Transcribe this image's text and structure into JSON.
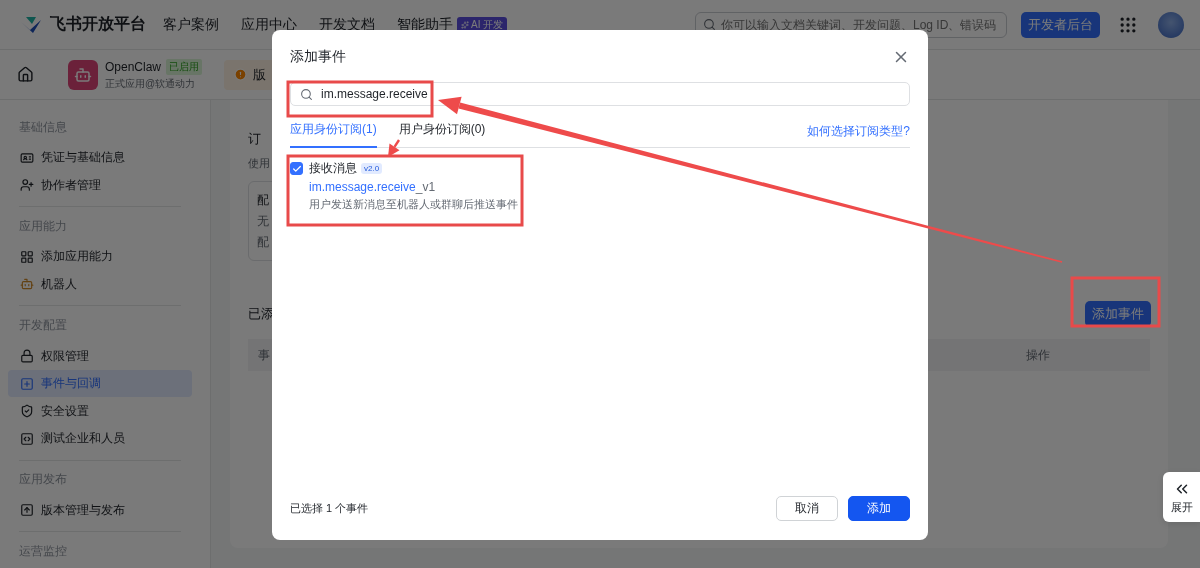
{
  "header": {
    "logo": "飞书开放平台",
    "nav": [
      {
        "label": "客户案例"
      },
      {
        "label": "应用中心"
      },
      {
        "label": "开发文档"
      },
      {
        "label": "智能助手",
        "badge": "AI 开发"
      }
    ],
    "search": {
      "placeholder": "你可以输入文档关键词、开发问题、Log ID、错误码"
    },
    "console_button": "开发者后台"
  },
  "app_bar": {
    "app_name": "OpenClaw",
    "status": "已启用",
    "subtitle": "正式应用@软通动力",
    "notice": "版"
  },
  "sidebar": {
    "groups": [
      {
        "title": "基础信息",
        "items": [
          {
            "label": "凭证与基础信息",
            "selected": false
          },
          {
            "label": "协作者管理",
            "selected": false
          }
        ]
      },
      {
        "title": "应用能力",
        "items": [
          {
            "label": "添加应用能力",
            "selected": false
          },
          {
            "label": "机器人",
            "selected": false
          }
        ]
      },
      {
        "title": "开发配置",
        "items": [
          {
            "label": "权限管理",
            "selected": false
          },
          {
            "label": "事件与回调",
            "selected": true
          },
          {
            "label": "安全设置",
            "selected": false
          },
          {
            "label": "测试企业和人员",
            "selected": false
          }
        ]
      },
      {
        "title": "应用发布",
        "items": [
          {
            "label": "版本管理与发布",
            "selected": false
          }
        ]
      },
      {
        "title": "运营监控"
      }
    ]
  },
  "main": {
    "section_title": "订",
    "section_desc": "使用",
    "config_box": {
      "title": "配",
      "lines": [
        "无",
        "配"
      ]
    },
    "added_title": "已添",
    "add_button": "添加事件",
    "table": {
      "columns": [
        "事",
        "操作"
      ]
    }
  },
  "modal": {
    "title": "添加事件",
    "search": {
      "value": "im.message.receive"
    },
    "tabs": [
      {
        "label": "应用身份订阅(1)",
        "selected": true
      },
      {
        "label": "用户身份订阅(0)",
        "selected": false
      }
    ],
    "help_link": "如何选择订阅类型?",
    "events": [
      {
        "name": "接收消息",
        "version": "v2.0",
        "key": "im.message.receive",
        "key_suffix": "_v1",
        "description": "用户发送新消息至机器人或群聊后推送事件",
        "checked": true
      }
    ],
    "footer_text": "已选择 1 个事件",
    "buttons": [
      {
        "label": "取消",
        "kind": "secondary"
      },
      {
        "label": "添加",
        "kind": "primary"
      }
    ]
  },
  "side_tab": {
    "label": "展开"
  }
}
